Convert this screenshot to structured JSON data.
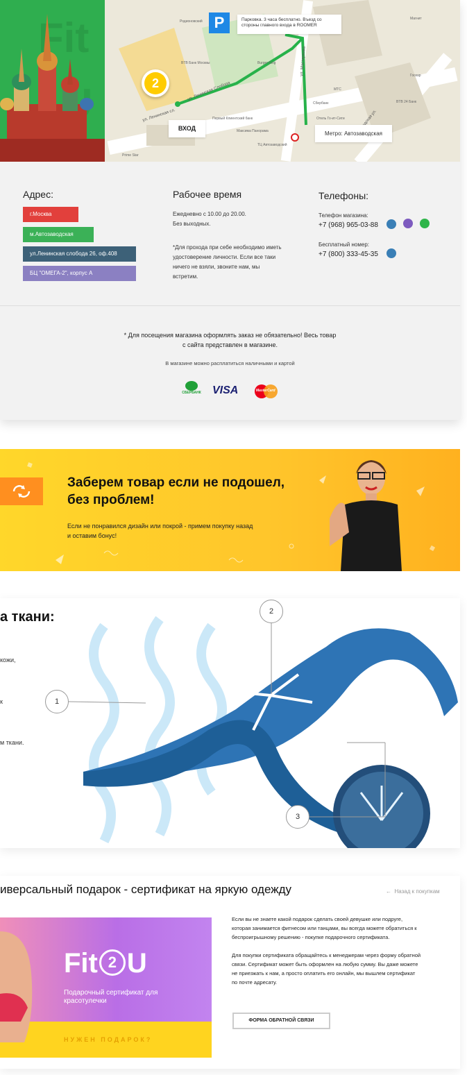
{
  "map": {
    "parking_note": "Парковка. 3 часа бесплатно. Въезд со стороны главного входа в ROOMER",
    "entrance_label": "ВХОД",
    "metro_label": "Метро: Автозаводская",
    "pin_number": "2",
    "parking_letter": "P",
    "street_1": "ул. Ленинская Слобода",
    "street_2": "ул. Мастеркова",
    "street_3": "Автозаводская ул.",
    "street_4": "ул. Ленинская сл.",
    "poi": [
      "Родионовский",
      "BTB Банк Москвы",
      "Burger King",
      "Первый Клиентский банк",
      "Максима Панорама",
      "ТЦ Автозаводский",
      "Отель Го-ит-Сити",
      "Prime Star",
      "Госкар",
      "BTB 24 Банк",
      "Магнит",
      "МТС",
      "Сбербанк"
    ],
    "bg_color": "#ece8da",
    "route_color": "#27b24a"
  },
  "contacts": {
    "address_title": "Адрес:",
    "address_chips": [
      {
        "text": "г.Москва",
        "color": "#e2403c"
      },
      {
        "text": "м.Автозаводская",
        "color": "#3bb157"
      },
      {
        "text": "ул.Ленинская слобода 26, оф.408",
        "color": "#3d6178"
      },
      {
        "text": "БЦ \"ОМЕГА-2\", корпус А",
        "color": "#8b80c2"
      }
    ],
    "hours_title": "Рабочее время",
    "hours_line1": "Ежедневно с 10.00 до 20.00.",
    "hours_line2": "Без выходных.",
    "hours_note_1": "*Для прохода при себе необходимо иметь",
    "hours_note_2": "удостоверение личности. Если все таки",
    "hours_note_3": "ничего не взяли, звоните нам, мы",
    "hours_note_4": "встретим.",
    "phones_title": "Телефоны:",
    "shop_phone_label": "Телефон магазина:",
    "shop_phone": "+7 (968) 965-03-88",
    "free_phone_label": "Бесплатный номер:",
    "free_phone": "+7 (800) 333-45-35",
    "notice_line1": "* Для посещения магазина оформлять заказ не обязательно! Весь товар",
    "notice_line2": "с сайта представлен в магазине.",
    "payment_note": "В магазине можно расплатиться наличными и картой",
    "sber_label": "СБЕРБАНК",
    "visa_label": "VISA",
    "mc_label": "MasterCard"
  },
  "banner": {
    "headline_1": "Заберем товар если не подошел,",
    "headline_2": "без проблем!",
    "text_1": "Если не понравился дизайн или покрой - примем покупку назад",
    "text_2": "и оставим бонус!"
  },
  "fabric": {
    "title": "а ткани:",
    "side_1": "кожи,",
    "side_2": "к",
    "side_3": "м ткани.",
    "n1": "1",
    "n2": "2",
    "n3": "3"
  },
  "gift": {
    "title": "иверсальный подарок - сертификат на яркую одежду",
    "back_link": "Назад к покупкам",
    "logo_a": "Fit",
    "logo_num": "2",
    "logo_b": "U",
    "cert_line1": "Подарочный сертификат для",
    "cert_line2": "красотулечки",
    "cta": "НУЖЕН ПОДАРОК?",
    "p1_l1": "Если вы не знаете какой подарок сделать своей девушке или подруге,",
    "p1_l2": "которая занимается фитнесом или танцами, вы всегда можете обратиться к",
    "p1_l3": "беспроигрышному решению - покупке подарочного сертификата.",
    "p2_l1": "Для покупки сертификата обращайтесь к менеджерам через форму обратной",
    "p2_l2": "связи. Сертификат может быть оформлен на любую сумму. Вы даже можете",
    "p2_l3": "не приезжать к нам, а просто оплатить его онлайн, мы вышлем сертификат",
    "p2_l4": "по почте адресату.",
    "button": "ФОРМА ОБРАТНОЙ СВЯЗИ"
  }
}
